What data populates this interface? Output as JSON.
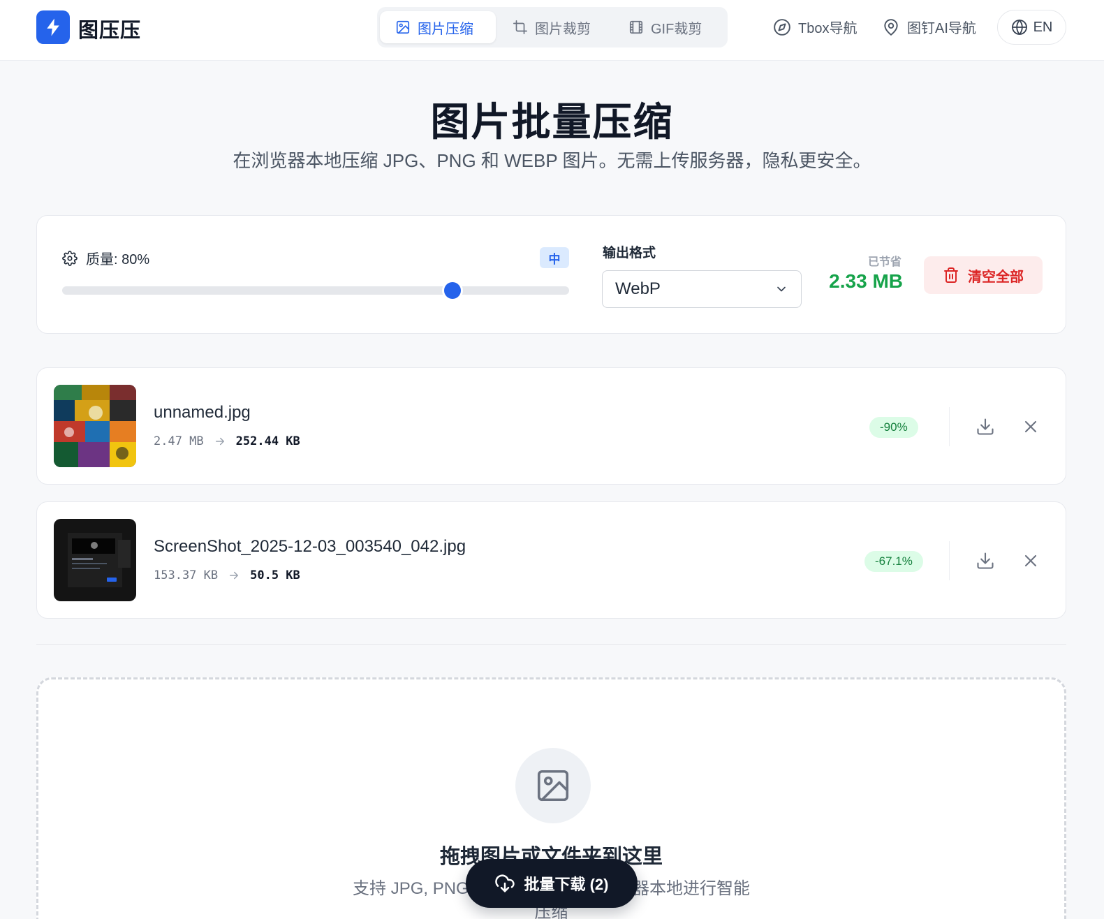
{
  "app": {
    "name": "图压压",
    "brand_color": "#2563eb"
  },
  "nav": {
    "tabs": [
      {
        "label": "图片压缩",
        "icon": "image-icon",
        "active": true
      },
      {
        "label": "图片裁剪",
        "icon": "crop-icon",
        "active": false
      },
      {
        "label": "GIF裁剪",
        "icon": "film-icon",
        "active": false
      }
    ],
    "links": [
      {
        "label": "Tbox导航",
        "icon": "compass-icon"
      },
      {
        "label": "图钉AI导航",
        "icon": "map-pin-icon"
      }
    ],
    "language": "EN"
  },
  "hero": {
    "title": "图片批量压缩",
    "subtitle": "在浏览器本地压缩 JPG、PNG 和 WEBP 图片。无需上传服务器，隐私更安全。"
  },
  "settings": {
    "quality_label": "质量: 80%",
    "quality_value": 80,
    "quality_level": "中",
    "format_label": "输出格式",
    "format_value": "WebP",
    "saved_label": "已节省",
    "saved_value": "2.33 MB",
    "clear_label": "清空全部"
  },
  "files": [
    {
      "name": "unnamed.jpg",
      "original_size": "2.47 MB",
      "compressed_size": "252.44 KB",
      "reduction": "-90%"
    },
    {
      "name": "ScreenShot_2025-12-03_003540_042.jpg",
      "original_size": "153.37 KB",
      "compressed_size": "50.5 KB",
      "reduction": "-67.1%"
    }
  ],
  "dropzone": {
    "title": "拖拽图片或文件夹到这里",
    "subtitle_line1": "支持 JPG, PNG, WEBP 格式，在浏览器本地进行智能",
    "subtitle_line2": "压缩"
  },
  "batch_download": {
    "label": "批量下载 (2)"
  },
  "colors": {
    "success": "#16a34a",
    "danger": "#dc2626",
    "dark": "#111827"
  }
}
